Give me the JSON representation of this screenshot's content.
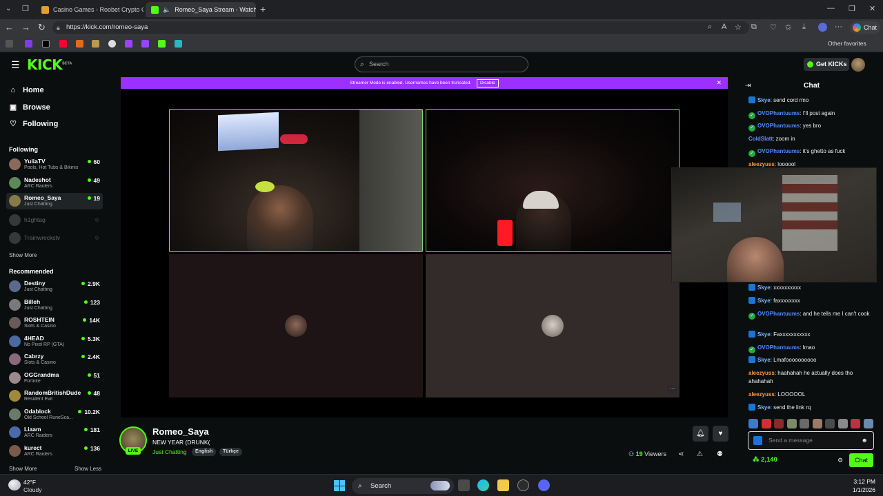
{
  "browser": {
    "tabs": [
      {
        "title": "Casino Games - Roobet Crypto Ca",
        "active": false
      },
      {
        "title": "Romeo_Saya Stream - Watch",
        "active": true
      }
    ],
    "new_tab": "+",
    "url": "https://kick.com/romeo-saya",
    "copilot_label": "Chat",
    "other_favorites": "Other favorites"
  },
  "kick": {
    "logo": "KICK",
    "logo_badge": "BETA",
    "search_placeholder": "Search",
    "get_kicks": "Get KICKs"
  },
  "sidebar": {
    "nav": [
      {
        "label": "Home",
        "icon": "home-icon"
      },
      {
        "label": "Browse",
        "icon": "browse-icon"
      },
      {
        "label": "Following",
        "icon": "heart-icon"
      }
    ],
    "following_header": "Following",
    "following": [
      {
        "name": "YuliaTV",
        "game": "Pools, Hot Tubs & Bikinis",
        "viewers": "60",
        "color": "#8a6a5a"
      },
      {
        "name": "Nadeshot",
        "game": "ARC Raiders",
        "viewers": "49",
        "color": "#5a8a5a"
      },
      {
        "name": "Romeo_Saya",
        "game": "Just Chatting",
        "viewers": "19",
        "color": "#8a7a4a"
      },
      {
        "name": "h1ghtag",
        "offline": true,
        "color": "#777"
      },
      {
        "name": "Trainwreckstv",
        "offline": true,
        "color": "#777"
      }
    ],
    "show_more_following": "Show More",
    "recommended_header": "Recommended",
    "recommended": [
      {
        "name": "Destiny",
        "game": "Just Chatting",
        "viewers": "2.9K",
        "color": "#5a6a8a"
      },
      {
        "name": "Billeh",
        "game": "Just Chatting",
        "viewers": "123",
        "color": "#7a7a7a"
      },
      {
        "name": "ROSHTEIN",
        "game": "Slots & Casino",
        "viewers": "14K",
        "color": "#6a5a5a"
      },
      {
        "name": "4HEAD",
        "game": "No Pixel RP (GTA)",
        "viewers": "5.3K",
        "color": "#4a6aa0"
      },
      {
        "name": "Cabrzy",
        "game": "Slots & Casino",
        "viewers": "2.4K",
        "color": "#8a6a7a"
      },
      {
        "name": "OGGrandma",
        "game": "Fortnite",
        "viewers": "51",
        "color": "#9a8a8a"
      },
      {
        "name": "RandomBritishDude",
        "game": "Resident Evil",
        "viewers": "48",
        "color": "#a08a3a"
      },
      {
        "name": "Odablock",
        "game": "Old School RuneSca...",
        "viewers": "10.2K",
        "color": "#6a7a6a"
      },
      {
        "name": "Liaam",
        "game": "ARC Raiders",
        "viewers": "181",
        "color": "#4a6aaa"
      },
      {
        "name": "kurect",
        "game": "ARC Raiders",
        "viewers": "136",
        "color": "#7a5a4a"
      }
    ],
    "show_more": "Show More",
    "show_less": "Show Less"
  },
  "player": {
    "banner_text": "Streamer Mode is enabled. Usernames have been truncated.",
    "banner_disable": "Disable",
    "more_options": "···"
  },
  "stream": {
    "streamer": "Romeo_Saya",
    "live": "LIVE",
    "title": "NEW YEAR (DRUNK(",
    "category": "Just Chatting",
    "tags": [
      "English",
      "Türkçe"
    ],
    "viewer_count": "19",
    "viewer_label": "Viewers"
  },
  "chat": {
    "header": "Chat",
    "messages_top": [
      {
        "user": "Skye",
        "badge": "skye",
        "text": "send cord rmo",
        "color": "#7ab8ff"
      },
      {
        "user": "OVOPhantuums",
        "badge": "ovo",
        "text": "I'll post again",
        "color": "#4f8bff"
      },
      {
        "user": "OVOPhantuums",
        "badge": "ovo",
        "text": "yes bro",
        "color": "#4f8bff"
      },
      {
        "user": "ColdSlatt",
        "badge": "",
        "text": "zoom in",
        "color": "#6a8fff"
      },
      {
        "user": "OVOPhantuums",
        "badge": "ovo",
        "text": "it's ghetto as fuck",
        "color": "#4f8bff"
      },
      {
        "user": "aleezyuss",
        "badge": "",
        "text": "loooool",
        "color": "#ff9a3c"
      }
    ],
    "messages_bottom": [
      {
        "user": "Skye",
        "badge": "skye",
        "text": "xxxxxxxxxx",
        "color": "#7ab8ff"
      },
      {
        "user": "Skye",
        "badge": "skye",
        "text": "faxxxxxxxx",
        "color": "#7ab8ff"
      },
      {
        "user": "OVOPhantuums",
        "badge": "ovo",
        "text": "and he tells me I can't cook",
        "color": "#4f8bff"
      },
      {
        "user": "Skye",
        "badge": "skye",
        "text": "Faxxxxxxxxxxx",
        "color": "#7ab8ff"
      },
      {
        "user": "OVOPhantuums",
        "badge": "ovo",
        "text": "lmao",
        "color": "#4f8bff"
      },
      {
        "user": "Skye",
        "badge": "skye",
        "text": "Lmafoooooooooo",
        "color": "#7ab8ff"
      },
      {
        "user": "aleezyuss",
        "badge": "",
        "text": "haahahah he actually does tho ahahahah",
        "color": "#ff9a3c"
      },
      {
        "user": "aleezyuss",
        "badge": "",
        "text": "LOOOOOL",
        "color": "#ff9a3c"
      },
      {
        "user": "Skye",
        "badge": "skye",
        "text": "send the link rq",
        "color": "#7ab8ff"
      }
    ],
    "input_placeholder": "Send a message",
    "points": "2,140",
    "send_label": "Chat"
  },
  "taskbar": {
    "temperature": "42°F",
    "condition": "Cloudy",
    "search": "Search",
    "time": "3:12 PM",
    "date": "1/1/2026"
  }
}
